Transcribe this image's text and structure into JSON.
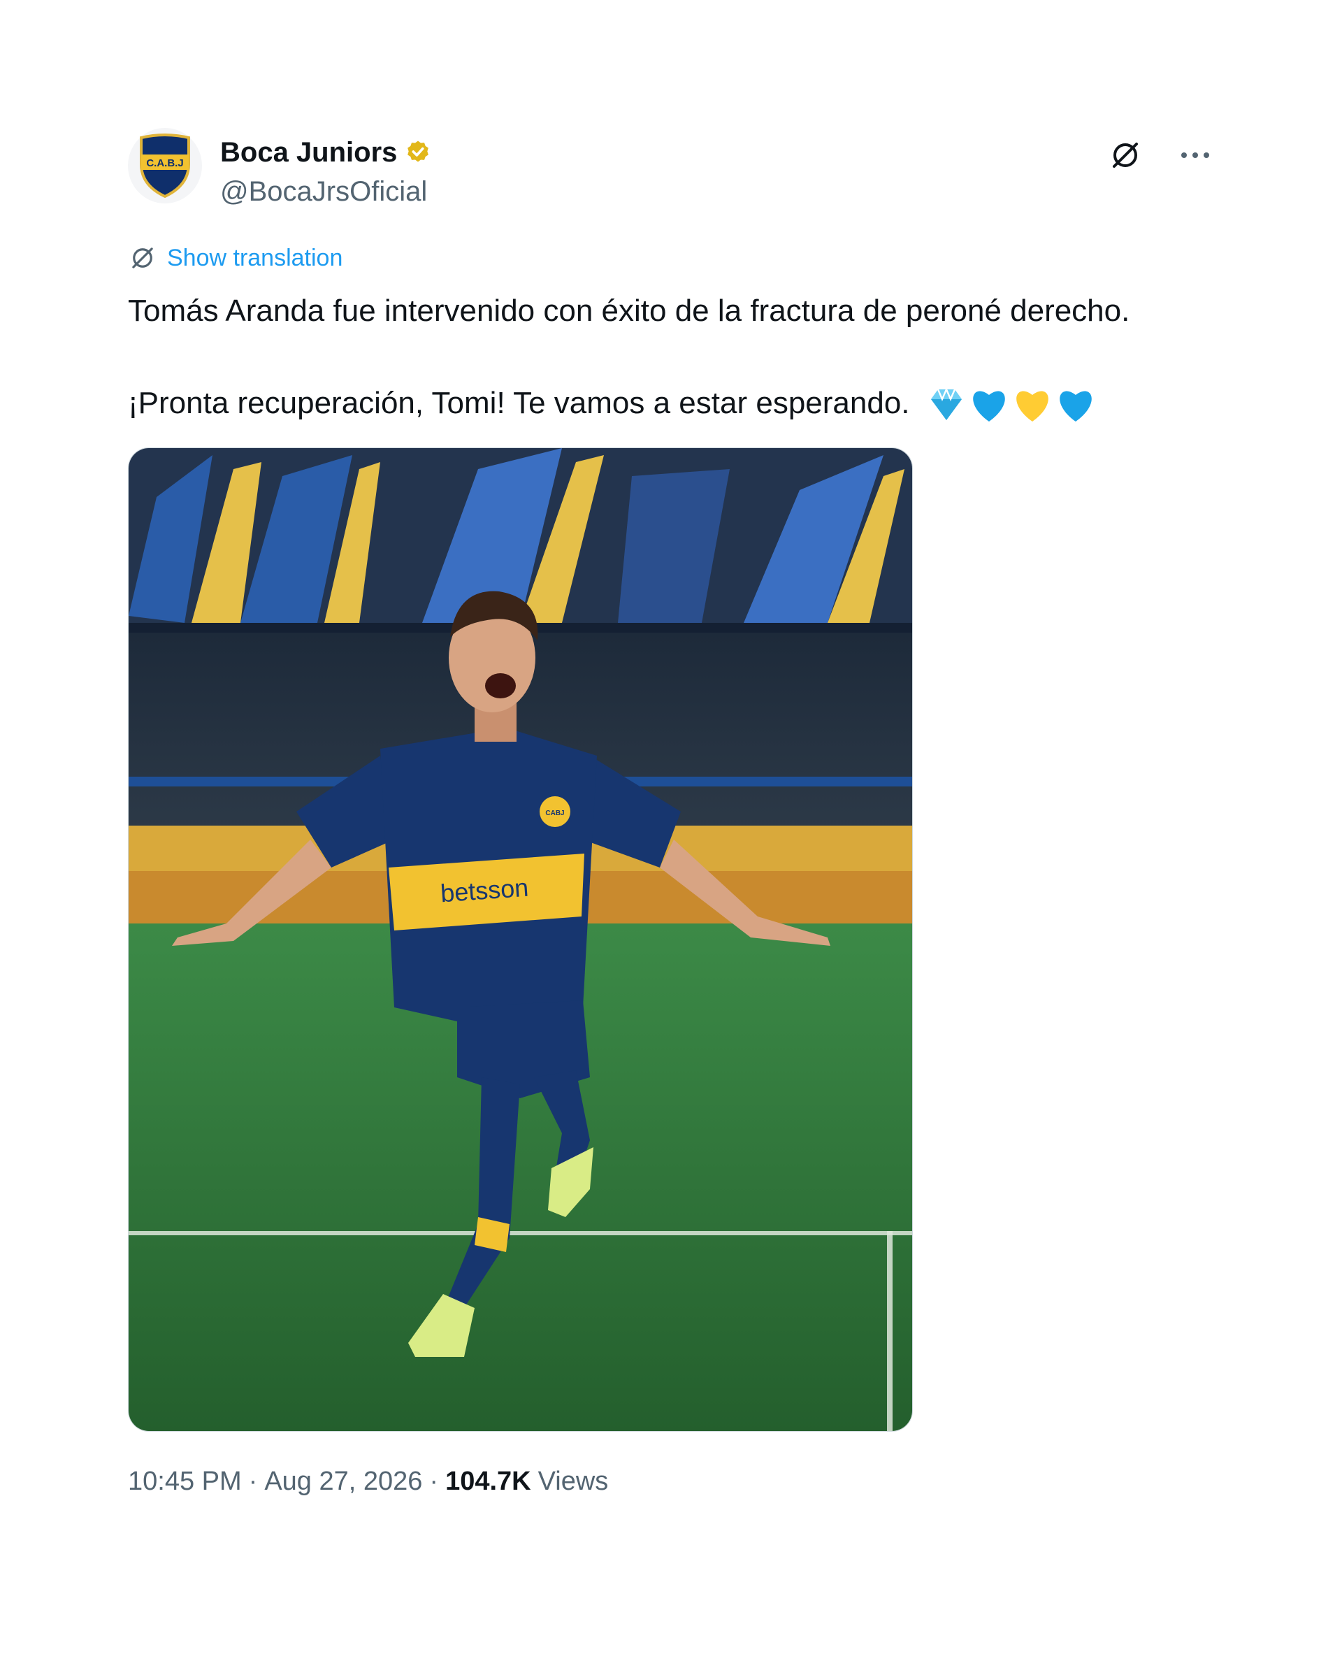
{
  "author": {
    "name": "Boca Juniors",
    "handle": "@BocaJrsOficial",
    "verified": true,
    "avatar_icon": "cabj-crest-icon",
    "avatar_text": "C.A.B.J"
  },
  "actions": {
    "grok_icon": "grok-icon",
    "more_icon": "more-icon"
  },
  "translation": {
    "label": "Show translation",
    "icon": "translate-icon"
  },
  "tweet": {
    "line1": "Tomás Aranda fue intervenido con éxito de la fractura de peroné derecho.",
    "line2": "¡Pronta recuperación, Tomi! Te vamos a estar esperando.",
    "emojis": [
      "gem",
      "blue-heart",
      "yellow-heart",
      "blue-heart"
    ]
  },
  "media": {
    "kind": "photo",
    "jersey_sponsor": "betsson",
    "crest_text": "CABJ"
  },
  "meta": {
    "time": "10:45 PM",
    "separator": "·",
    "date": "Aug 27, 2026",
    "views_count": "104.7K",
    "views_label": "Views"
  },
  "colors": {
    "accent": "#1d9bf0",
    "verified": "#e2b719",
    "boca_blue": "#103c7a",
    "boca_gold": "#f2c230",
    "pitch": "#2e7a3a"
  }
}
